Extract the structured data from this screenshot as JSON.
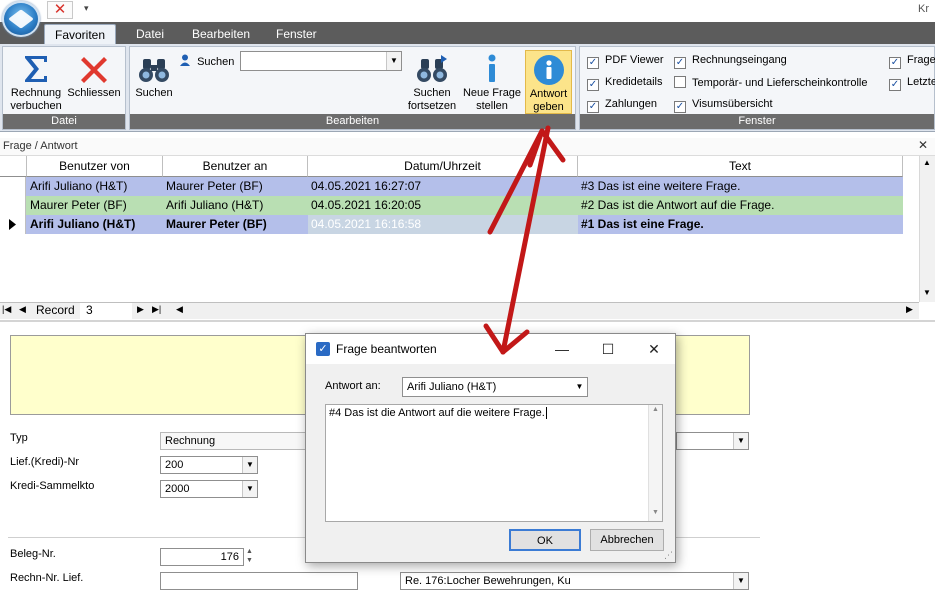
{
  "window": {
    "title_fragment": "Kr",
    "quick_access_close": "✕",
    "quick_access_dropdown": "▾"
  },
  "ribbon": {
    "tabs": [
      {
        "label": "Favoriten",
        "active": true
      },
      {
        "label": "Datei"
      },
      {
        "label": "Bearbeiten"
      },
      {
        "label": "Fenster"
      }
    ],
    "groups": {
      "datei": {
        "label": "Datei",
        "buttons": {
          "rechnung_verbuchen": [
            "Rechnung",
            "verbuchen"
          ],
          "schliessen": "Schliessen"
        }
      },
      "bearbeiten": {
        "label": "Bearbeiten",
        "search_label": "Suchen",
        "search_value": "",
        "buttons": {
          "suchen": "Suchen",
          "suchen_fortsetzen": [
            "Suchen",
            "fortsetzen"
          ],
          "neue_frage": [
            "Neue Frage",
            "stellen"
          ],
          "antwort_geben": [
            "Antwort",
            "geben"
          ]
        }
      },
      "fenster": {
        "label": "Fenster",
        "checks": [
          {
            "label": "PDF Viewer",
            "checked": true
          },
          {
            "label": "Kredidetails",
            "checked": true
          },
          {
            "label": "Zahlungen",
            "checked": true
          },
          {
            "label": "Rechnungseingang",
            "checked": true
          },
          {
            "label": "Temporär- und Lieferscheinkontrolle",
            "checked": false
          },
          {
            "label": "Visumsübersicht",
            "checked": true
          },
          {
            "label": "Frage",
            "checked": true
          },
          {
            "label": "Letzte",
            "checked": true
          }
        ]
      }
    }
  },
  "panel": {
    "title": "Frage / Antwort",
    "close": "✕",
    "columns": [
      "Benutzer von",
      "Benutzer an",
      "Datum/Uhrzeit",
      "Text"
    ],
    "rows": [
      {
        "von": "Arifi Juliano (H&T)",
        "an": "Maurer Peter (BF)",
        "datum": "04.05.2021 16:27:07",
        "text": "#3 Das ist eine weitere Frage.",
        "color": "#b4bfea",
        "bold": false
      },
      {
        "von": "Maurer Peter (BF)",
        "an": "Arifi Juliano (H&T)",
        "datum": "04.05.2021 16:20:05",
        "text": "#2 Das ist die Antwort auf die Frage.",
        "color": "#b9dfb3",
        "bold": false
      },
      {
        "von": "Arifi Juliano (H&T)",
        "an": "Maurer Peter (BF)",
        "datum": "04.05.2021 16:16:58",
        "text": "#1 Das ist eine Frage.",
        "color": "#b4bfea",
        "bold": true,
        "current": true
      }
    ],
    "navigator": {
      "label": "Record",
      "value": "3"
    }
  },
  "form": {
    "typ_label": "Typ",
    "typ_value": "Rechnung",
    "lief_label": "Lief.(Kredi)-Nr",
    "lief_value": "200",
    "kredi_label": "Kredi-Sammelkto",
    "kredi_value": "2000",
    "beleg_label": "Beleg-Nr.",
    "beleg_value": "176",
    "rechn_label": "Rechn-Nr. Lief.",
    "rechn_value": "",
    "re_value": "Re. 176:Locher Bewehrungen, Ku"
  },
  "dialog": {
    "title": "Frage beantworten",
    "answer_to_label": "Antwort an:",
    "answer_to_value": "Arifi Juliano (H&T)",
    "text": "#4 Das ist die Antwort auf die weitere Frage.",
    "ok": "OK",
    "cancel": "Abbrechen"
  },
  "colors": {
    "annotation_arrow": "#c21818",
    "ribbon_highlight": "#fce48a"
  }
}
